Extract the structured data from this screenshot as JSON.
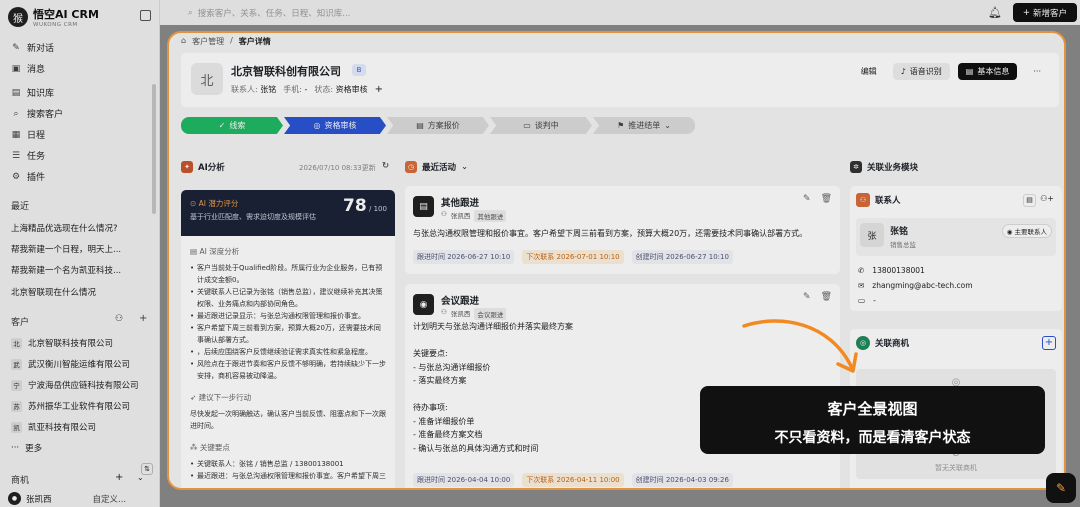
{
  "app": {
    "name": "悟空AI CRM",
    "sub": "WUKONG CRM",
    "logo": "猴"
  },
  "topbar": {
    "search_placeholder": "搜索客户、关系、任务、日程、知识库...",
    "new_btn": "新增客户"
  },
  "sidebar": {
    "nav": [
      {
        "label": "新对话",
        "icon": "✎"
      },
      {
        "label": "消息",
        "icon": "▣"
      },
      {
        "label": "知识库",
        "icon": "▤"
      },
      {
        "label": "搜索客户",
        "icon": "⌕"
      },
      {
        "label": "日程",
        "icon": "▦"
      },
      {
        "label": "任务",
        "icon": "☰"
      },
      {
        "label": "插件",
        "icon": "⚙"
      }
    ],
    "recent_title": "最近",
    "recent": [
      "上海精品优选现在什么情况?",
      "帮我新建一个日程，明天上...",
      "帮我新建一个名为凯亚科技...",
      "北京智联现在什么情况"
    ],
    "customers_title": "客户",
    "customers": [
      {
        "av": "北",
        "name": "北京智联科技有限公司"
      },
      {
        "av": "武",
        "name": "武汉衡川智能运维有限公司"
      },
      {
        "av": "宁",
        "name": "宁波海岳供应链科技有限公司"
      },
      {
        "av": "苏",
        "name": "苏州振华工业软件有限公司"
      },
      {
        "av": "凯",
        "name": "凯亚科技有限公司"
      }
    ],
    "more": "更多",
    "opps_title": "商机",
    "user": {
      "name": "张凯西",
      "custom": "自定义..."
    }
  },
  "breadcrumb": {
    "parent": "客户管理",
    "current": "客户详情"
  },
  "customer": {
    "avatar": "北",
    "name": "北京智联科创有限公司",
    "badge": "B",
    "contact_label": "联系人:",
    "contact": "张铭",
    "phone_label": "手机:",
    "phone": "-",
    "status_label": "状态:",
    "status": "资格审核"
  },
  "header_actions": {
    "edit": "编辑",
    "voice": "语音识别",
    "info": "基本信息",
    "more": "···"
  },
  "stages": [
    {
      "label": "线索",
      "icon": "✓"
    },
    {
      "label": "资格审核",
      "icon": "◎"
    },
    {
      "label": "方案报价",
      "icon": "▤"
    },
    {
      "label": "谈判中",
      "icon": "▭"
    },
    {
      "label": "推进结单",
      "icon": "⚑"
    }
  ],
  "ai": {
    "title": "AI分析",
    "time": "2026/07/10 08:33更新",
    "score_title": "AI 潜力评分",
    "score_desc": "基于行业匹配度、需求迫切度及规模评估",
    "score": "78",
    "score_max": "/ 100",
    "deep_title": "AI 深度分析",
    "deep": [
      "客户当前处于Qualified阶段。所属行业为企业服务，已有预计成交金额0。",
      "关键联系人已记录为张铭（销售总监），建议继续补充其决策权限、业务痛点和内部协同角色。",
      "最近跟进记录显示：与张总沟通权限管理和报价事宜。",
      "客户希望下周三前看到方案，预算大概20万，还需要技术同事确认部署方式。",
      "，后续应围绕客户反馈继续验证需求真实性和紧急程度。",
      "风险点在于跟进节奏和客户反馈不够明确，若持续缺少下一步安排，商机容易被动降温。"
    ],
    "next_title": "建议下一步行动",
    "next": "尽快发起一次明确触达，确认客户当前反馈、阻塞点和下一次跟进时间。",
    "key_title": "关键要点",
    "key": [
      "关键联系人：张铭 / 销售总监 / 13800138001",
      "最近跟进：与张总沟通权限管理和报价事宜。客户希望下周三"
    ]
  },
  "activity": {
    "title": "最近活动",
    "cards": [
      {
        "icon": "▤",
        "title": "其他跟进",
        "author": "张凯西",
        "tag": "其他跟进",
        "text": "与张总沟通权限管理和报价事宜。客户希望下周三前看到方案，预算大概20万，还需要技术同事确认部署方式。",
        "f1": "跟进时间 2026-06-27 10:10",
        "f2": "下次联系 2026-07-01 10:10",
        "f3": "创建时间 2026-06-27 10:10"
      },
      {
        "icon": "◉",
        "title": "会议跟进",
        "author": "张凯西",
        "tag": "会议跟进",
        "text": "计划明天与张总沟通详细报价并落实最终方案\n\n关键要点:\n- 与张总沟通详细报价\n- 落实最终方案\n\n待办事项:\n- 准备详细报价单\n- 准备最终方案文档\n- 确认与张总的具体沟通方式和时间",
        "f1": "跟进时间 2026-04-04 10:00",
        "f2": "下次联系 2026-04-11 10:00",
        "f3": "创建时间 2026-04-03 09:26"
      }
    ]
  },
  "related": {
    "title": "关联业务模块",
    "contacts_title": "联系人",
    "contact": {
      "av": "张",
      "name": "张铭",
      "role": "销售总监",
      "primary": "主要联系人",
      "phone": "13800138001",
      "email": "zhangming@abc-tech.com",
      "note": "-"
    },
    "opps_title": "关联商机",
    "empty": "暂无关联商机"
  },
  "overlay": {
    "line1": "客户全景视图",
    "line2": "不只看资料，而是看清客户状态"
  }
}
